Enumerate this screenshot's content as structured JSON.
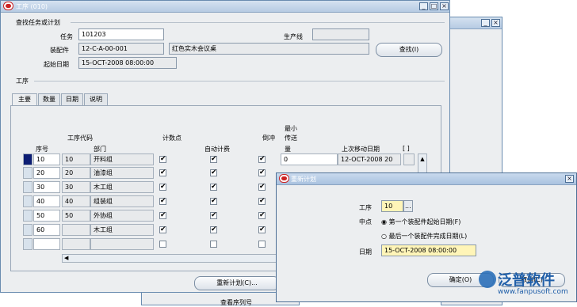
{
  "back_window": {
    "title": "",
    "controls": [
      "_",
      "×"
    ]
  },
  "main_window": {
    "title": "工序 (010)",
    "controls": [
      "_",
      "□",
      "×"
    ],
    "find_group": {
      "title": "查找任务或计划"
    },
    "labels": {
      "task": "任务",
      "assembly": "装配件",
      "start_date": "起始日期",
      "production_line": "生产线"
    },
    "values": {
      "task": "101203",
      "assembly": "12-C-A-00-001",
      "assembly_desc": "红色实木会议桌",
      "start_date": "15-OCT-2008 08:00:00",
      "production_line": ""
    },
    "find_button": "查找(I)",
    "operations_group": {
      "title": "工序"
    },
    "tabs": [
      "主要",
      "数量",
      "日期",
      "说明"
    ],
    "table": {
      "headers": {
        "seq": "序号",
        "op_code": "工序代码",
        "dept": "部门",
        "count_point": "计数点",
        "auto_charge": "自动计费",
        "backflush": "倒冲",
        "min_transfer_1": "最小",
        "min_transfer_2": "传送",
        "min_transfer_3": "量",
        "last_move": "上次移动日期",
        "bracket": "[ ]"
      },
      "rows": [
        {
          "seq": "10",
          "code": "10",
          "dept": "开料组",
          "count": true,
          "auto": true,
          "back": true,
          "min": "0",
          "last": "12-OCT-2008 20"
        },
        {
          "seq": "20",
          "code": "20",
          "dept": "油漆组",
          "count": true,
          "auto": true,
          "back": true,
          "min": "",
          "last": ""
        },
        {
          "seq": "30",
          "code": "30",
          "dept": "木工组",
          "count": true,
          "auto": true,
          "back": true,
          "min": "",
          "last": ""
        },
        {
          "seq": "40",
          "code": "40",
          "dept": "组装组",
          "count": true,
          "auto": true,
          "back": true,
          "min": "",
          "last": ""
        },
        {
          "seq": "50",
          "code": "50",
          "dept": "外协组",
          "count": true,
          "auto": true,
          "back": true,
          "min": "",
          "last": ""
        },
        {
          "seq": "60",
          "code": "",
          "dept": "木工组",
          "count": true,
          "auto": true,
          "back": true,
          "min": "",
          "last": ""
        },
        {
          "seq": "",
          "code": "",
          "dept": "",
          "count": false,
          "auto": false,
          "back": false,
          "min": "",
          "last": ""
        }
      ]
    },
    "reschedule_button": "重新计划(C)..."
  },
  "dialog": {
    "title": "重新计划",
    "close": "×",
    "labels": {
      "operation": "工序",
      "midpoint": "中点",
      "date": "日期"
    },
    "operation_value": "10",
    "lov_button": "...",
    "options": [
      "第一个装配件起始日期(F)",
      "最后一个装配件完成日期(L)"
    ],
    "date_value": "15-OCT-2008 08:00:00",
    "ok_button": "确定(O)",
    "cancel_button": "取消(C)"
  },
  "bottom_text": "查看序列号",
  "watermark": {
    "brand": "泛普软件",
    "url": "www.fanpusoft.com"
  }
}
